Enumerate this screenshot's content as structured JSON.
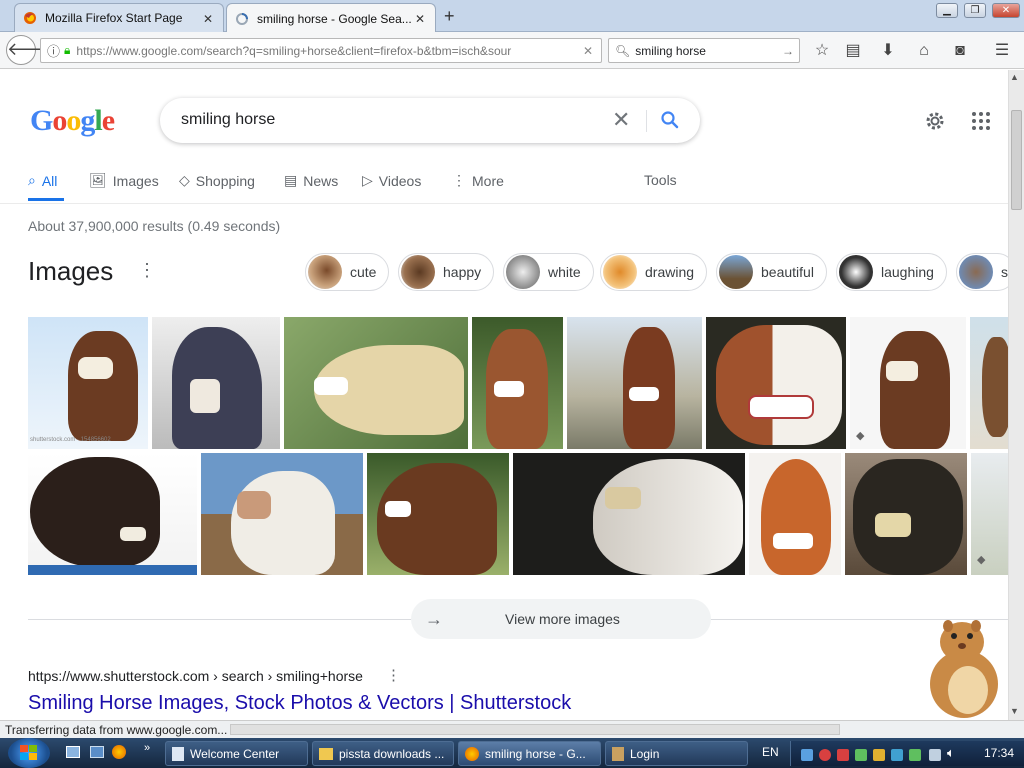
{
  "browser": {
    "tabs": [
      {
        "title": "Mozilla Firefox Start Page"
      },
      {
        "title": "smiling horse - Google Sea..."
      }
    ],
    "new_tab": "+",
    "url": "https://www.google.com/search?q=smiling+horse&client=firefox-b&tbm=isch&sour",
    "search_bar": "smiling horse"
  },
  "google": {
    "logo": "Google",
    "query": "smiling horse",
    "tabs": [
      {
        "label": "All"
      },
      {
        "label": "Images"
      },
      {
        "label": "Shopping"
      },
      {
        "label": "News"
      },
      {
        "label": "Videos"
      },
      {
        "label": "More"
      }
    ],
    "tools": "Tools",
    "result_stats": "About 37,900,000 results (0.49 seconds)",
    "images_heading": "Images",
    "chips": [
      "cute",
      "happy",
      "white",
      "drawing",
      "beautiful",
      "laughing",
      "s"
    ],
    "image_source_label": "shutterstock.com · 154856602",
    "view_more": "View more images",
    "result": {
      "breadcrumb": "https://www.shutterstock.com › search › smiling+horse",
      "title": "Smiling Horse Images, Stock Photos & Vectors | Shutterstock"
    }
  },
  "status_text": "Transferring data from www.google.com...",
  "taskbar": {
    "items": [
      "Welcome Center",
      "pissta downloads ...",
      "smiling horse - G...",
      "Login"
    ],
    "lang": "EN",
    "clock": "17:34"
  },
  "colors": {
    "accent_blue": "#1a73e8",
    "link": "#1a0dab",
    "tab_bg": "#c6d6ea",
    "taskbar": "#1c3352"
  }
}
